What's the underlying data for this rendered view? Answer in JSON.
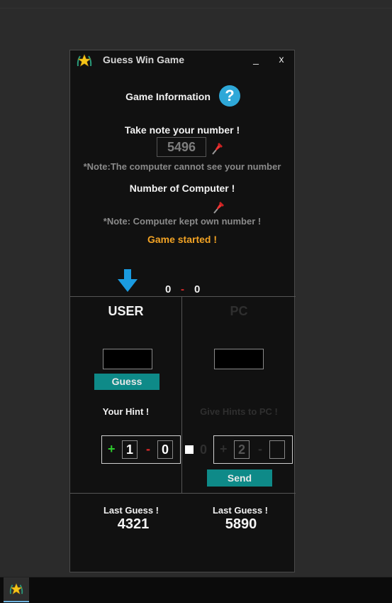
{
  "window": {
    "title": "Guess Win Game",
    "minimize_label": "_",
    "close_label": "x"
  },
  "info": {
    "heading": "Game Information",
    "help_glyph": "?"
  },
  "user_number": {
    "heading": "Take note your number !",
    "value": "5496",
    "note": "*Note:The computer cannot see your number"
  },
  "computer_number": {
    "heading": "Number of Computer !",
    "note": "*Note: Computer kept own number !"
  },
  "status": "Game started !",
  "score": {
    "user": "0",
    "separator": "-",
    "pc": "0"
  },
  "user_panel": {
    "title": "USER",
    "guess_button": "Guess",
    "hint_label": "Your Hint !",
    "hint_plus_sign": "+",
    "hint_plus_value": "1",
    "hint_minus_sign": "-",
    "hint_minus_value": "0"
  },
  "pc_panel": {
    "title": "PC",
    "hint_label": "Give Hints to PC !",
    "zero_label": "0",
    "hint_plus_sign": "+",
    "hint_plus_value": "2",
    "hint_minus_sign": "-",
    "hint_minus_value": "",
    "send_button": "Send"
  },
  "last_guess": {
    "user_label": "Last Guess !",
    "user_value": "4321",
    "pc_label": "Last Guess !",
    "pc_value": "5890"
  },
  "colors": {
    "accent_teal": "#0e8a88",
    "status_orange": "#f2a324",
    "help_blue": "#2ea8d8",
    "plus_green": "#2ecc2e",
    "minus_red": "#e02a2a"
  },
  "icons": {
    "app": "star-badge-icon",
    "pin": "pushpin-icon",
    "arrow": "arrow-down-icon",
    "help": "question-icon"
  }
}
